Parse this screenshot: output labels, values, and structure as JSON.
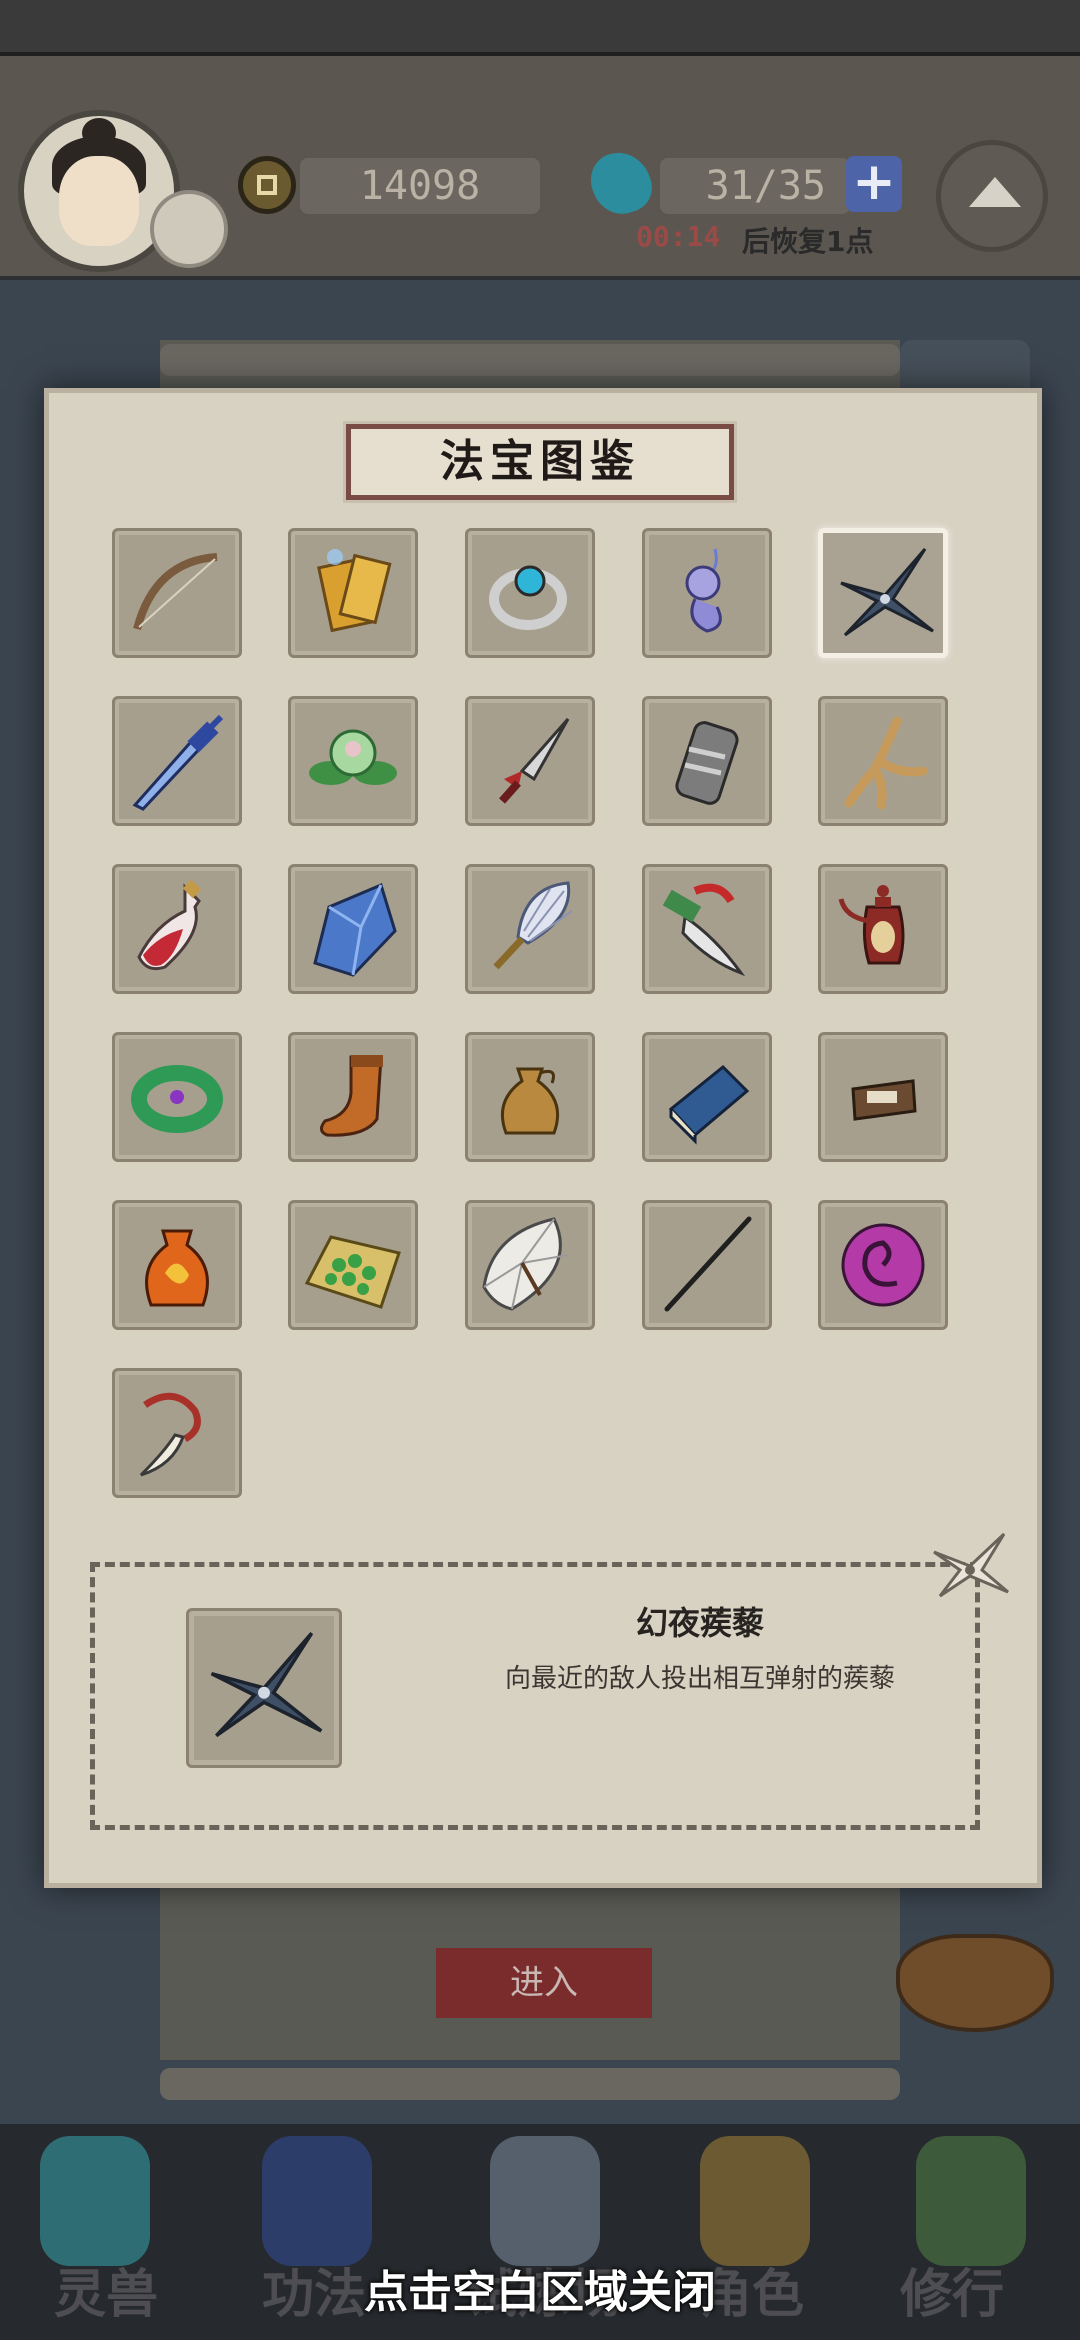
{
  "header": {
    "coins": "14098",
    "stamina": "31/35",
    "recover_time": "00:14",
    "recover_text": "后恢复1点"
  },
  "background": {
    "enter_label": "进入"
  },
  "panel": {
    "title": "法宝图鉴",
    "items": [
      {
        "name": "bow-icon"
      },
      {
        "name": "talisman-icon"
      },
      {
        "name": "ring-icon"
      },
      {
        "name": "charm-icon"
      },
      {
        "name": "shuriken-icon",
        "selected": true
      },
      {
        "name": "sword-icon"
      },
      {
        "name": "lotus-icon"
      },
      {
        "name": "dagger-icon"
      },
      {
        "name": "bracer-icon"
      },
      {
        "name": "ginseng-icon"
      },
      {
        "name": "potion-icon"
      },
      {
        "name": "crystal-icon"
      },
      {
        "name": "feather-fan-icon"
      },
      {
        "name": "curved-blade-icon"
      },
      {
        "name": "teapot-icon"
      },
      {
        "name": "jade-bracelet-icon"
      },
      {
        "name": "boot-icon"
      },
      {
        "name": "pouch-icon"
      },
      {
        "name": "book-icon"
      },
      {
        "name": "box-icon"
      },
      {
        "name": "fire-bag-icon"
      },
      {
        "name": "herb-mat-icon"
      },
      {
        "name": "umbrella-icon"
      },
      {
        "name": "needle-icon"
      },
      {
        "name": "vortex-orb-icon"
      },
      {
        "name": "fang-necklace-icon"
      }
    ],
    "selected_item": {
      "name": "幻夜蒺藜",
      "description": "向最近的敌人投出相互弹射的蒺藜"
    }
  },
  "nav": {
    "items": [
      "灵兽",
      "功法",
      "试炼场",
      "角色",
      "修行"
    ]
  },
  "close_hint": "点击空白区域关闭"
}
